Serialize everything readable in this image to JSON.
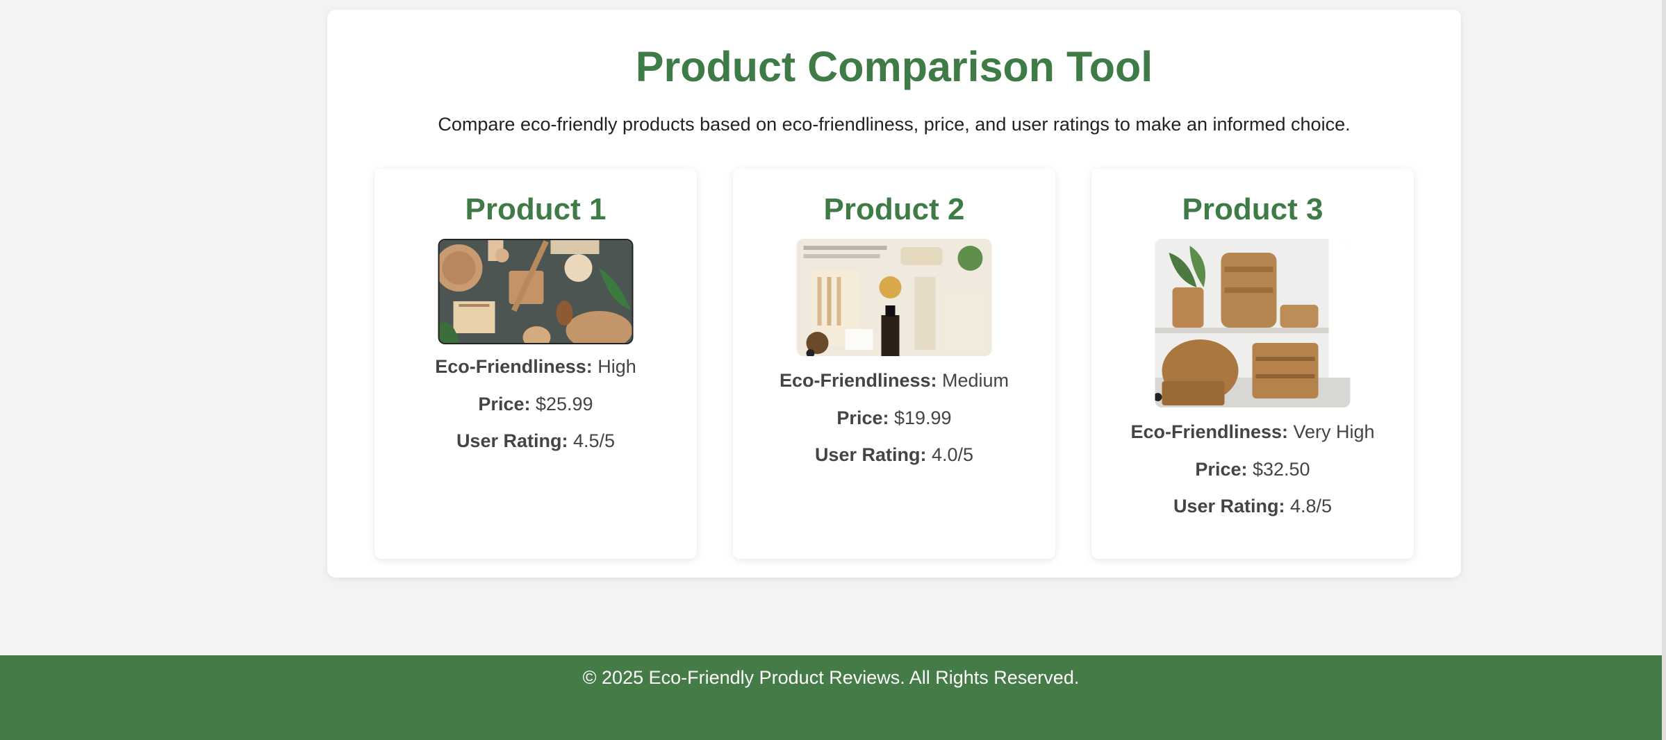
{
  "header": {
    "title": "Product Comparison Tool",
    "subtitle": "Compare eco-friendly products based on eco-friendliness, price, and user ratings to make an informed choice."
  },
  "labels": {
    "eco": "Eco-Friendliness:",
    "price": "Price:",
    "rating": "User Rating:"
  },
  "products": [
    {
      "name": "Product 1",
      "eco": "High",
      "price": "$25.99",
      "rating": "4.5/5"
    },
    {
      "name": "Product 2",
      "eco": "Medium",
      "price": "$19.99",
      "rating": "4.0/5"
    },
    {
      "name": "Product 3",
      "eco": "Very High",
      "price": "$32.50",
      "rating": "4.8/5"
    }
  ],
  "footer": {
    "text": "© 2025 Eco-Friendly Product Reviews. All Rights Reserved."
  },
  "colors": {
    "accent": "#3e7b47",
    "footer": "#447b47",
    "background": "#f3f3f3"
  }
}
